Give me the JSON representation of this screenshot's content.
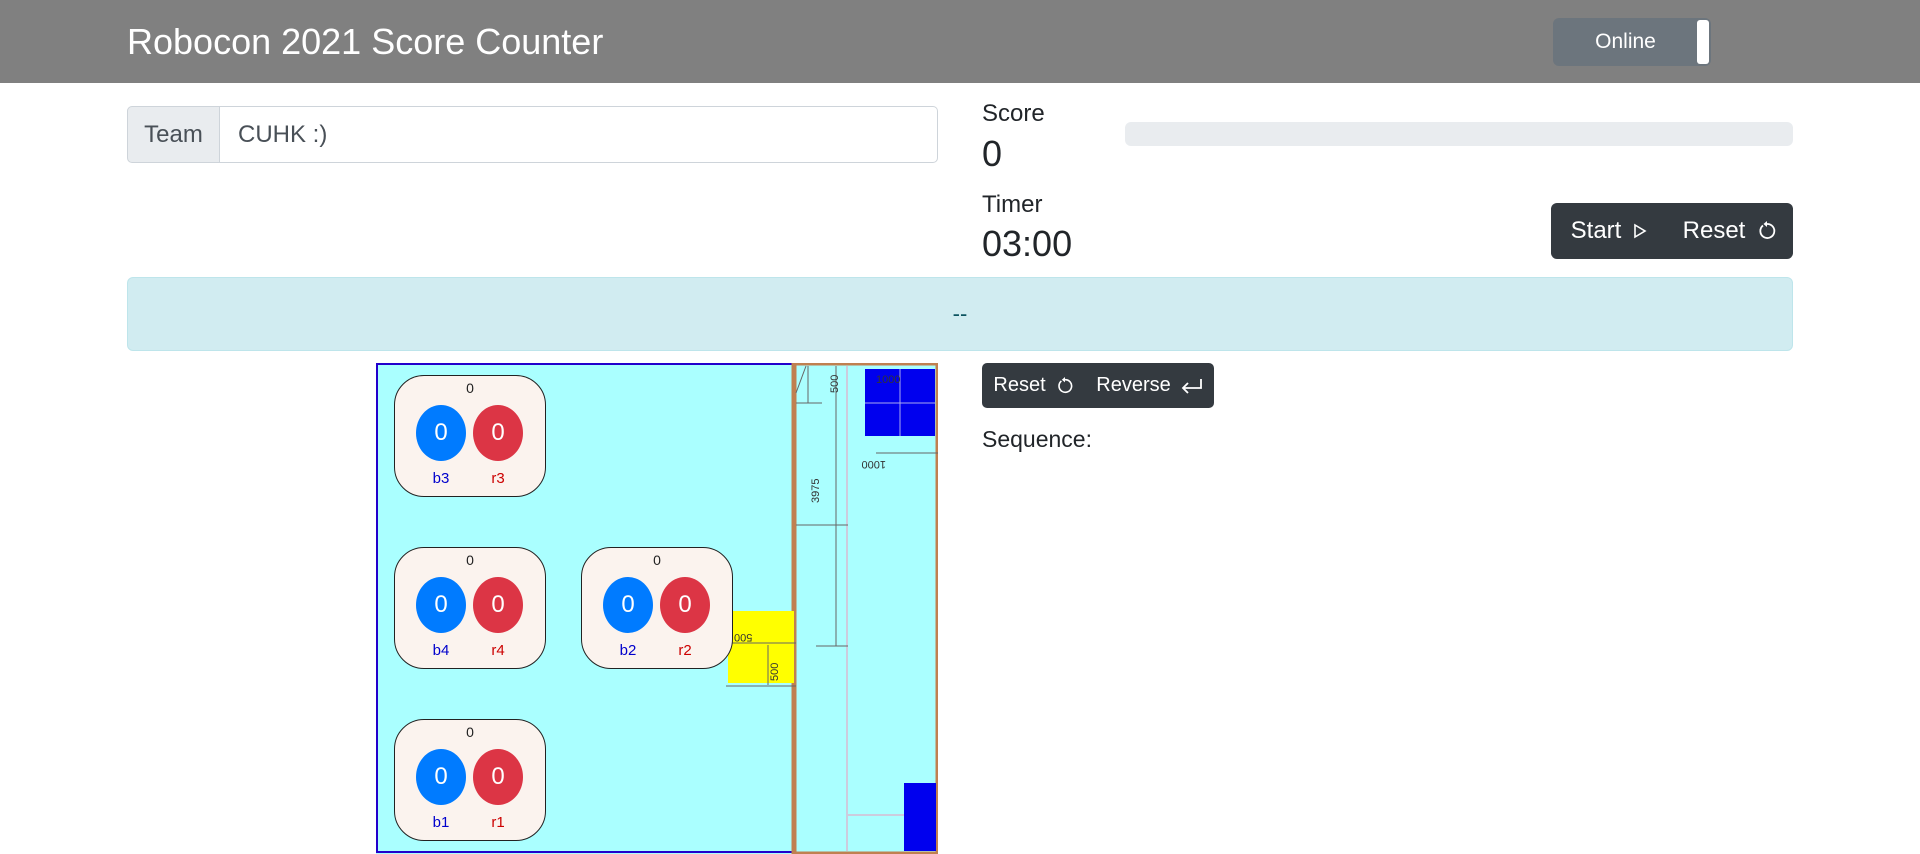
{
  "header": {
    "title": "Robocon 2021 Score Counter",
    "online_label": "Online"
  },
  "team": {
    "prefix": "Team",
    "value": "CUHK :)"
  },
  "score": {
    "label": "Score",
    "value": "0",
    "progress_fraction": 0
  },
  "timer": {
    "label": "Timer",
    "value": "03:00",
    "start_label": "Start",
    "reset_label": "Reset"
  },
  "alert": {
    "message": "--"
  },
  "field": {
    "dimensions": [
      "500",
      "1000",
      "1000",
      "3975",
      "500",
      "500"
    ],
    "racks": [
      {
        "id": "rack-3",
        "total": "0",
        "blue_value": "0",
        "red_value": "0",
        "blue_label": "b3",
        "red_label": "r3",
        "highlighted": true
      },
      {
        "id": "rack-4",
        "total": "0",
        "blue_value": "0",
        "red_value": "0",
        "blue_label": "b4",
        "red_label": "r4",
        "highlighted": false
      },
      {
        "id": "rack-2",
        "total": "0",
        "blue_value": "0",
        "red_value": "0",
        "blue_label": "b2",
        "red_label": "r2",
        "highlighted": false
      },
      {
        "id": "rack-1",
        "total": "0",
        "blue_value": "0",
        "red_value": "0",
        "blue_label": "b1",
        "red_label": "r1",
        "highlighted": false
      }
    ]
  },
  "sequence": {
    "reset_label": "Reset",
    "reverse_label": "Reverse",
    "label": "Sequence:"
  },
  "colors": {
    "navbar": "#808080",
    "field_floor": "#aaffff",
    "blue_ball": "#007bff",
    "red_ball": "#dc3545",
    "rack_highlight": "#fb9b9b",
    "dark_button": "#343a40",
    "alert_bg": "#d1ecf1"
  },
  "icons": {
    "start": "play-icon",
    "reset": "reset-icon",
    "reverse": "return-icon"
  }
}
